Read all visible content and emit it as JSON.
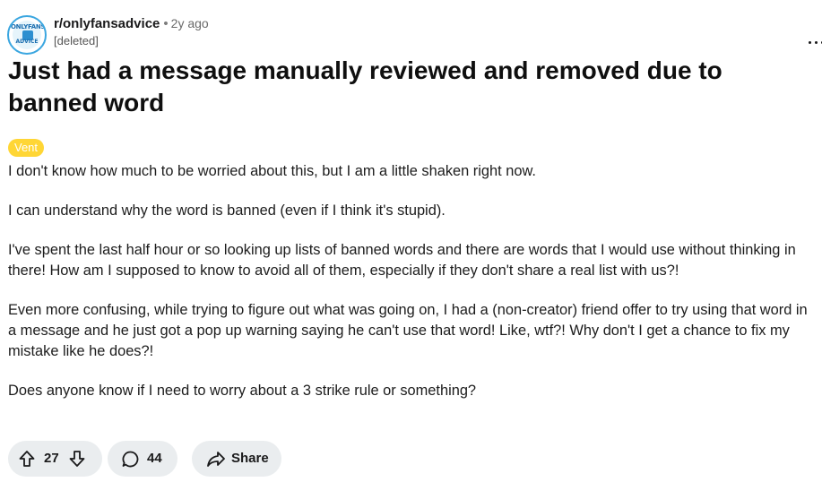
{
  "post": {
    "subreddit": "r/onlyfansadvice",
    "separator": "•",
    "age": "2y ago",
    "author": "[deleted]",
    "avatar_text_top": "ONLYFANS",
    "avatar_text_bottom": "ADVICE",
    "title": "Just had a message manually reviewed and removed due to banned word",
    "flair": "Vent",
    "flair_color": "#ffd635",
    "paragraphs": [
      "I don't know how much to be worried about this, but I am a little shaken right now.",
      "I can understand why the word is banned (even if I think it's stupid).",
      "I've spent the last half hour or so looking up lists of banned words and there are words that I would use without thinking in there! How am I supposed to know to avoid all of them, especially if they don't share a real list with us?!",
      "Even more confusing, while trying to figure out what was going on, I had a (non-creator) friend offer to try using that word in a message and he just got a pop up warning saying he can't use that word! Like, wtf?! Why don't I get a chance to fix my mistake like he does?!",
      "Does anyone know if I need to worry about a 3 strike rule or something?"
    ]
  },
  "actions": {
    "upvotes": "27",
    "comments": "44",
    "share_label": "Share",
    "icons": [
      "upvote-icon",
      "downvote-icon",
      "comment-icon",
      "share-icon",
      "more-options-icon"
    ]
  }
}
